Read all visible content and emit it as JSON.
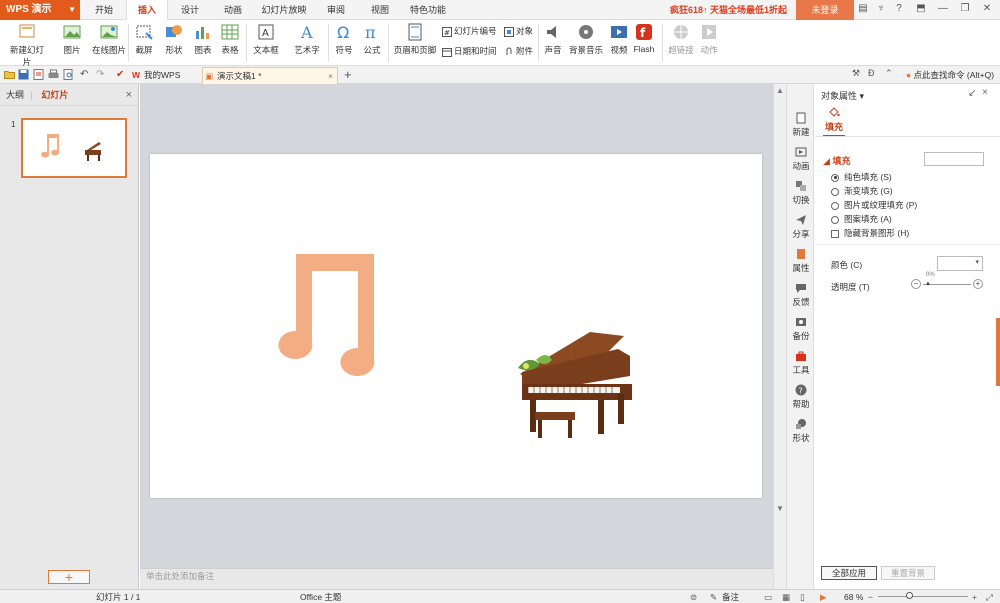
{
  "titlebar": {
    "app_name": "WPS 演示",
    "tabs": [
      "开始",
      "插入",
      "设计",
      "动画",
      "幻灯片放映",
      "审阅",
      "视图",
      "特色功能"
    ],
    "active_tab": "插入",
    "promo": "疯狂618↑ 天猫全场最低1折起",
    "login": "未登录",
    "help": "?"
  },
  "ribbon": {
    "new_slide": "新建幻灯片",
    "picture": "图片",
    "online_picture": "在线图片",
    "screenshot": "截屏",
    "shape": "形状",
    "chart": "图表",
    "table": "表格",
    "textbox": "文本框",
    "wordart": "艺术字",
    "symbol": "符号",
    "formula": "公式",
    "header_footer": "页眉和页脚",
    "slide_number": "幻灯片编号",
    "object": "对象",
    "date_time": "日期和时间",
    "attachment": "附件",
    "sound": "声音",
    "bg_music": "背景音乐",
    "video": "视频",
    "flash": "Flash",
    "hyperlink": "超链接",
    "action": "动作"
  },
  "quickbar": {
    "doc_tabs": [
      "我的WPS",
      "演示文稿1 *"
    ],
    "find_command": "点此查找命令 (Alt+Q)"
  },
  "left_panel": {
    "tab_outline": "大纲",
    "tab_slides": "幻灯片",
    "slide_number": "1"
  },
  "notes_placeholder": "单击此处添加备注",
  "sidebar": [
    "新建",
    "动画",
    "切换",
    "分享",
    "属性",
    "反馈",
    "备份",
    "工具",
    "帮助",
    "形状"
  ],
  "properties": {
    "title": "对象属性 ▾",
    "tab": "填充",
    "section": "填充",
    "options": [
      "纯色填充 (S)",
      "渐变填充 (G)",
      "图片或纹理填充 (P)",
      "图案填充 (A)"
    ],
    "selected_option": 0,
    "hide_bg": "隐藏背景图形 (H)",
    "color_label": "颜色 (C)",
    "transparency_label": "透明度 (T)",
    "transparency_value": "0%",
    "apply_all": "全部应用",
    "reset": "重置背景"
  },
  "statusbar": {
    "slide_info": "幻灯片 1 / 1",
    "theme": "Office 主题",
    "notes": "备注",
    "zoom": "68 %"
  },
  "colors": {
    "accent": "#e25b1c",
    "note_shape": "#f3ad82",
    "piano_wood": "#7a3e1c"
  }
}
